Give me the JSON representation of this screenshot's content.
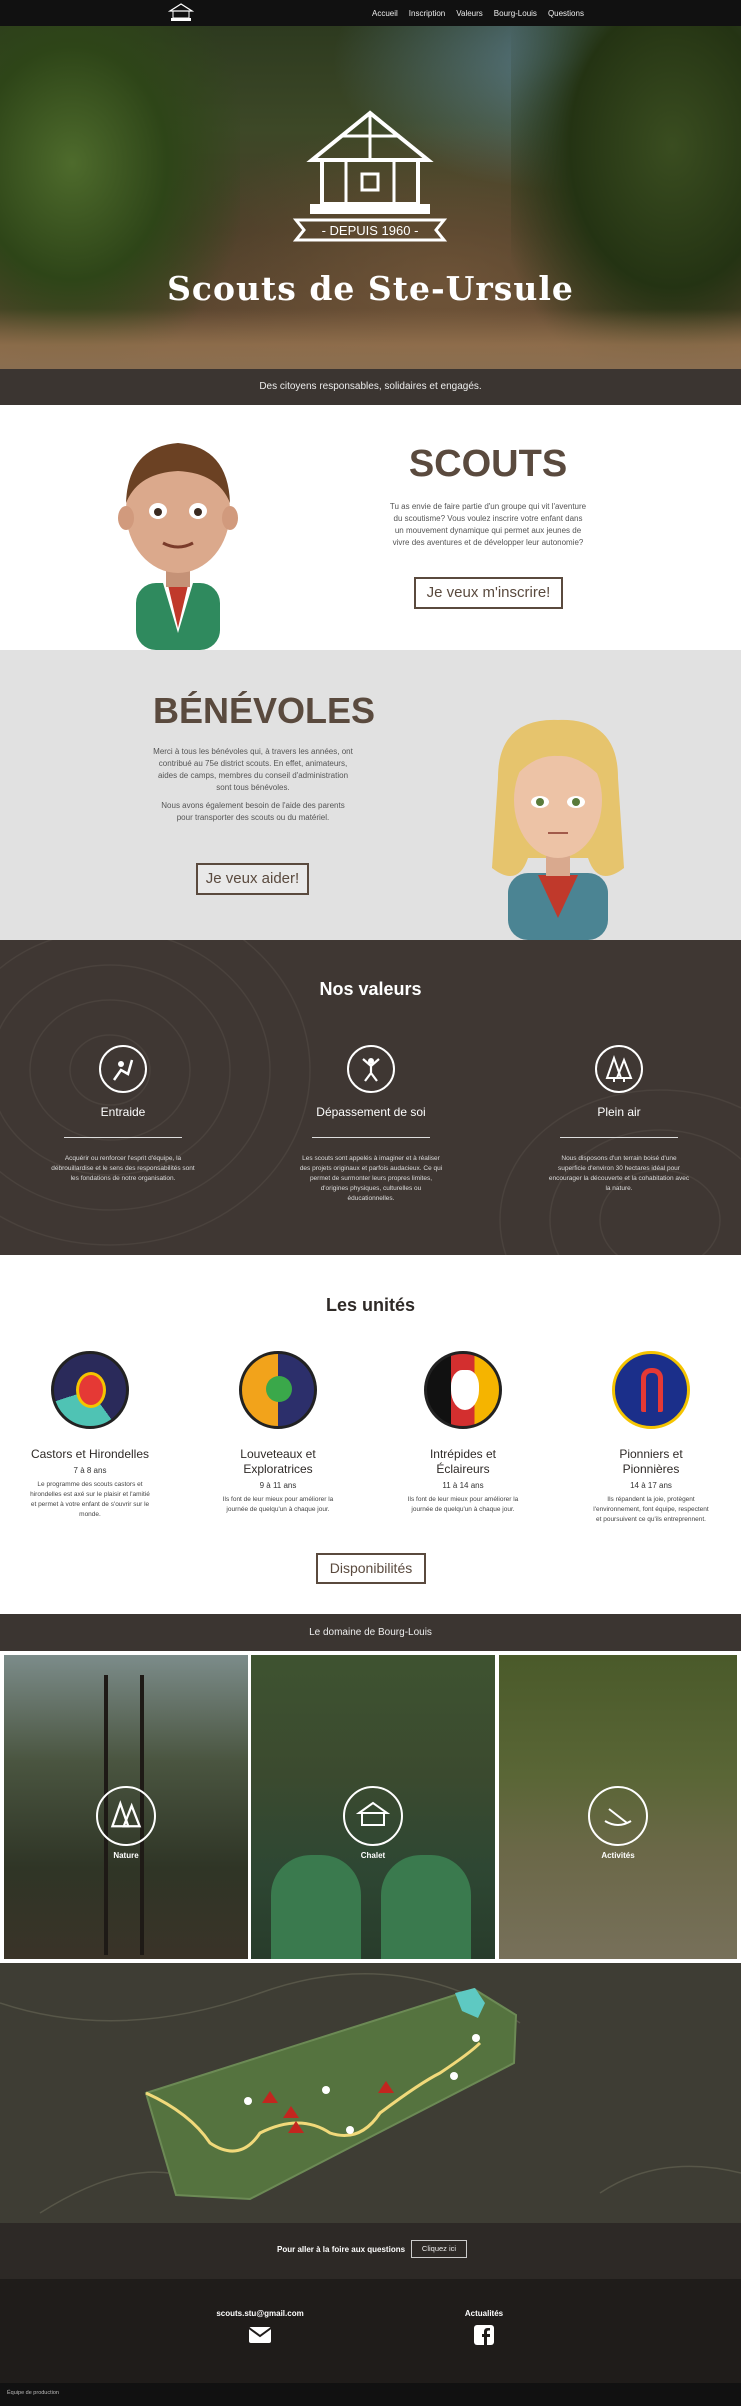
{
  "nav": {
    "items": [
      "Accueil",
      "Inscription",
      "Valeurs",
      "Bourg-Louis",
      "Questions"
    ]
  },
  "hero": {
    "since": "- DEPUIS 1960 -",
    "title": "Scouts de Ste-Ursule"
  },
  "tagline": "Des citoyens responsables, solidaires et engagés.",
  "scouts": {
    "title": "SCOUTS",
    "text": "Tu as envie de faire partie d'un groupe qui vit l'aventure du scoutisme? Vous voulez inscrire votre enfant dans un mouvement dynamique qui permet aux jeunes de vivre des aventures et de développer leur autonomie?",
    "button": "Je veux m'inscrire!"
  },
  "benevoles": {
    "title": "BÉNÉVOLES",
    "text1": "Merci à tous les bénévoles qui, à travers les années, ont contribué au 75e district scouts. En effet, animateurs, aides de camps, membres du conseil d'administration sont tous bénévoles.",
    "text2": "Nous avons également besoin de l'aide des parents pour transporter des scouts ou du matériel.",
    "button": "Je veux aider!"
  },
  "valeurs": {
    "title": "Nos valeurs",
    "items": [
      {
        "title": "Entraide",
        "icon": "climbing-help-icon",
        "text": "Acquérir ou renforcer l'esprit d'équipe, la débrouillardise et le sens des responsabilités sont les fondations de notre organisation."
      },
      {
        "title": "Dépassement de soi",
        "icon": "jumping-person-icon",
        "text": "Les scouts sont appelés à imaginer et à réaliser des projets originaux et parfois audacieux. Ce qui permet de surmonter leurs propres limites, d'origines physiques, culturelles ou éducationnelles."
      },
      {
        "title": "Plein air",
        "icon": "pine-trees-icon",
        "text": "Nous disposons d'un terrain boisé d'une superficie d'environ 30 hectares idéal pour encourager la découverte et la cohabitation avec la nature."
      }
    ]
  },
  "unites": {
    "title": "Les unités",
    "items": [
      {
        "name": "Castors et Hirondelles",
        "age": "7 à 8 ans",
        "text": "Le programme des scouts castors et hirondelles est axé sur le plaisir et l'amitié et permet à votre enfant de s'ouvrir sur le monde.",
        "colors": [
          "#2a2a5a",
          "#4fc3b4",
          "#e53935"
        ]
      },
      {
        "name": "Louveteaux et Exploratrices",
        "age": "9 à 11 ans",
        "text": "Ils font de leur mieux pour améliorer la journée de quelqu'un à chaque jour.",
        "colors": [
          "#f2a31b",
          "#2c2f6b",
          "#3aa84a"
        ]
      },
      {
        "name": "Intrépides et Éclaireurs",
        "age": "11 à 14 ans",
        "text": "Ils font de leur mieux pour améliorer la journée de quelqu'un à chaque jour.",
        "colors": [
          "#111111",
          "#d32f2f",
          "#f5b400"
        ]
      },
      {
        "name": "Pionniers et Pionnières",
        "age": "14 à 17 ans",
        "text": "Ils répandent la joie, protègent l'environnement, font équipe, respectent et poursuivent ce qu'ils entreprennent.",
        "colors": [
          "#1b2f8a",
          "#e53935",
          "#f5c400"
        ]
      }
    ],
    "button": "Disponibilités"
  },
  "domaine": {
    "title": "Le domaine de Bourg-Louis",
    "tiles": [
      {
        "label": "Nature",
        "icon": "pine-trees-icon"
      },
      {
        "label": "Chalet",
        "icon": "chalet-icon"
      },
      {
        "label": "Activités",
        "icon": "canoe-icon"
      }
    ]
  },
  "faq": {
    "text": "Pour aller à la foire aux questions",
    "button": "Cliquez ici"
  },
  "footer": {
    "email": "scouts.stu@gmail.com",
    "news": "Actualités"
  },
  "credits": "Équipe de production"
}
